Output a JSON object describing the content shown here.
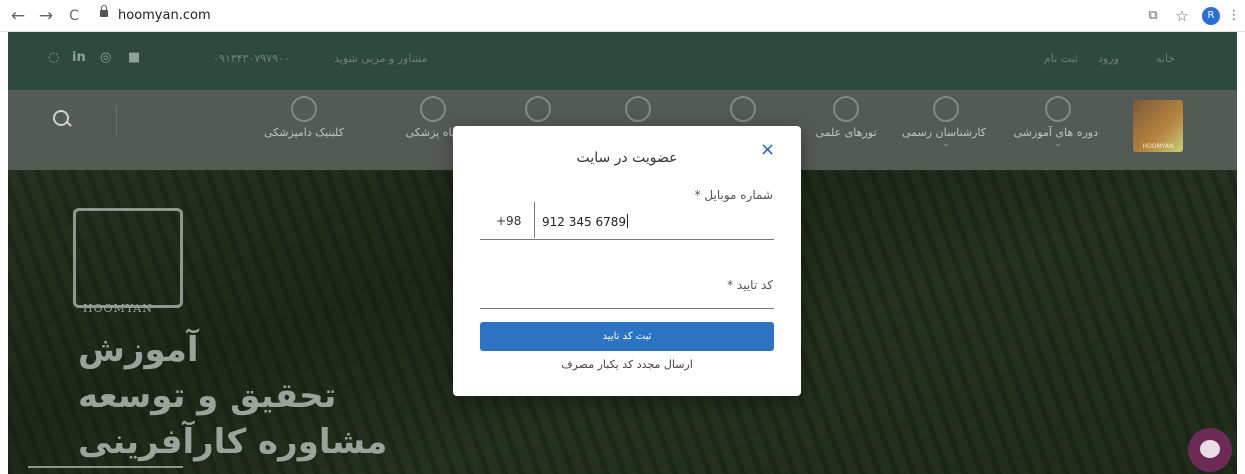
{
  "browser": {
    "url": "hoomyan.com",
    "back_icon": "←",
    "forward_icon": "→",
    "reload_icon": "C",
    "translate_icon": "⧉",
    "star_icon": "☆",
    "profile_initial": "R",
    "menu_icon": "⋮"
  },
  "topbar": {
    "phone_label": "۰۹۱۳۴۳۰۷۹۷۹۰۰",
    "consult_text": "مشاور و مربی شوید",
    "auth_login": "ورود",
    "auth_register": "ثبت نام",
    "home": "خانه",
    "social": [
      "in",
      "◎",
      "■"
    ]
  },
  "nav": {
    "items": [
      {
        "label": "دوره های آموزشی"
      },
      {
        "label": "کارشناسان رسمی"
      },
      {
        "label": "تورهای علمی"
      },
      {
        "label": "گیاه پزشکی"
      },
      {
        "label": "کلینیک دامپزشکی"
      }
    ],
    "logo_text": "HOOMYAN"
  },
  "hero": {
    "logo_text": "HOOMYAN",
    "lines": [
      "آموزش",
      "تحقیق و توسعه",
      "مشاوره کارآفرینی"
    ]
  },
  "modal": {
    "title": "عضویت در سایت",
    "close_icon": "×",
    "phone_label": "شماره موبایل *",
    "country_code": "+98",
    "phone_value": "912 345 6789",
    "code_label": "کد تایید *",
    "submit_label": "ثبت کد تایید",
    "resend_label": "ارسال مجدد کد یکبار مصرف"
  },
  "colors": {
    "accent": "#2c73c2",
    "topbar": "#2e4a3f",
    "chat": "#6e2a56"
  }
}
